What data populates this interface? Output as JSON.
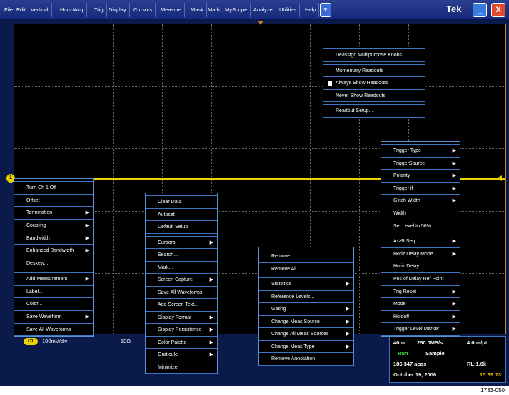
{
  "menubar": {
    "items": [
      "File",
      "Edit",
      "Vertical",
      "Horiz/Acq",
      "Trig",
      "Display",
      "Cursors",
      "Measure",
      "Mask",
      "Math",
      "MyScope",
      "Analyze",
      "Utilities",
      "Help"
    ],
    "brand": "Tek",
    "minimize_glyph": "_",
    "close_glyph": "X"
  },
  "channel_menu": {
    "items": [
      {
        "label": "Turn Ch 1 Off",
        "submenu": false
      },
      {
        "label": "Offset",
        "submenu": false
      },
      {
        "label": "Termination",
        "submenu": true
      },
      {
        "label": "Coupling",
        "submenu": true
      },
      {
        "label": "Bandwidth",
        "submenu": true
      },
      {
        "label": "Enhanced Bandwidth",
        "submenu": true
      },
      {
        "label": "Deskew...",
        "submenu": false
      },
      {
        "label": "Add Measurement",
        "submenu": true
      },
      {
        "label": "Label...",
        "submenu": false
      },
      {
        "label": "Color...",
        "submenu": false
      },
      {
        "label": "Save Waveform",
        "submenu": true
      },
      {
        "label": "Save All Waveforms",
        "submenu": false
      }
    ]
  },
  "display_menu": {
    "items": [
      {
        "label": "Clear Data",
        "submenu": false
      },
      {
        "label": "Autoset",
        "submenu": false
      },
      {
        "label": "Default Setup",
        "submenu": false
      },
      {
        "label": "Cursors",
        "submenu": true
      },
      {
        "label": "Search...",
        "submenu": false
      },
      {
        "label": "Mark...",
        "submenu": false
      },
      {
        "label": "Screen Capture",
        "submenu": true
      },
      {
        "label": "Save All Waveforms",
        "submenu": false
      },
      {
        "label": "Add Screen Text...",
        "submenu": false
      },
      {
        "label": "Display Format",
        "submenu": true
      },
      {
        "label": "Display Persistence",
        "submenu": true
      },
      {
        "label": "Color Palette",
        "submenu": true
      },
      {
        "label": "Graticule",
        "submenu": true
      },
      {
        "label": "Minimize",
        "submenu": false
      }
    ]
  },
  "measure_menu": {
    "items": [
      {
        "label": "Remove",
        "submenu": false
      },
      {
        "label": "Remove All",
        "submenu": false
      },
      {
        "label": "Statistics",
        "submenu": true
      },
      {
        "label": "Reference Levels...",
        "submenu": false
      },
      {
        "label": "Gating",
        "submenu": true
      },
      {
        "label": "Change Meas Source",
        "submenu": true
      },
      {
        "label": "Change All Meas Sources",
        "submenu": true
      },
      {
        "label": "Change Meas Type",
        "submenu": true
      },
      {
        "label": "Remove Annotation",
        "submenu": false
      }
    ]
  },
  "readout_menu": {
    "items": [
      {
        "label": "Deassign Multipurpose Knobs",
        "checked": false
      },
      {
        "label": "Momentary Readouts",
        "checked": false
      },
      {
        "label": "Always Show Readouts",
        "checked": true
      },
      {
        "label": "Never Show Readouts",
        "checked": false
      },
      {
        "label": "Readout Setup...",
        "checked": false
      }
    ]
  },
  "trigger_menu": {
    "items": [
      {
        "label": "Trigger Type",
        "submenu": true
      },
      {
        "label": "TriggerSource",
        "submenu": true
      },
      {
        "label": "Polarity",
        "submenu": true
      },
      {
        "label": "Trigger if",
        "submenu": true
      },
      {
        "label": "Glitch Width",
        "submenu": true
      },
      {
        "label": "Width",
        "submenu": false
      },
      {
        "label": "Set Level to 50%",
        "submenu": false
      },
      {
        "label": "A->B Seq",
        "submenu": true
      },
      {
        "label": "Horiz Delay Mode",
        "submenu": true
      },
      {
        "label": "Horiz Delay",
        "submenu": false
      },
      {
        "label": "Pos of Delay Ref Point",
        "submenu": false
      },
      {
        "label": "Trig Reset",
        "submenu": true
      },
      {
        "label": "Mode",
        "submenu": true
      },
      {
        "label": "Holdoff",
        "submenu": true
      },
      {
        "label": "Trigger Level Marker",
        "submenu": true
      }
    ]
  },
  "status": {
    "channel_badge": "C1",
    "scale": "100mV/div",
    "termination": "50Ω"
  },
  "acquisition": {
    "timebase": "40ns",
    "sample_rate": "250.0MS/s",
    "resolution": "4.0ns/pt",
    "run_state": "Run",
    "mode": "Sample",
    "acqs": "186 347 acqs",
    "record_length": "RL:1.0k",
    "date": "October 19, 2006",
    "time": "15:39:13"
  },
  "figure_label": "1733-050",
  "colors": {
    "trace": "#e8d400",
    "menu_border": "#3e74c4",
    "run": "#3ce03c",
    "time": "#e8c000",
    "graticule_border": "#d0801a"
  }
}
